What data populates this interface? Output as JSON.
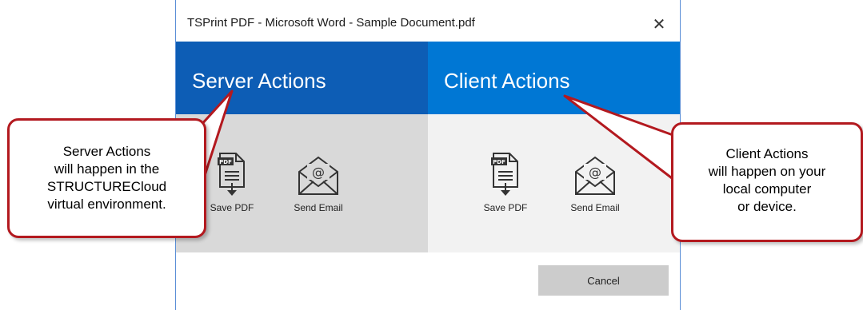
{
  "dialog": {
    "title": "TSPrint PDF - Microsoft Word - Sample Document.pdf",
    "close_symbol": "✕"
  },
  "server": {
    "header": "Server Actions",
    "actions": [
      {
        "label": "Save PDF",
        "icon": "pdf-file-download-icon"
      },
      {
        "label": "Send Email",
        "icon": "email-envelope-icon"
      }
    ]
  },
  "client": {
    "header": "Client Actions",
    "actions": [
      {
        "label": "Save PDF",
        "icon": "pdf-file-download-icon"
      },
      {
        "label": "Send Email",
        "icon": "email-envelope-icon"
      }
    ]
  },
  "footer": {
    "cancel_label": "Cancel"
  },
  "callouts": {
    "left_lines": [
      "Server Actions",
      "will happen in the",
      "STRUCTURECloud",
      "virtual environment."
    ],
    "right_lines": [
      "Client Actions",
      "will happen on your",
      "local computer",
      "or device."
    ]
  },
  "colors": {
    "server_header": "#0d5db5",
    "client_header": "#0077d4",
    "callout_border": "#b3191f"
  }
}
